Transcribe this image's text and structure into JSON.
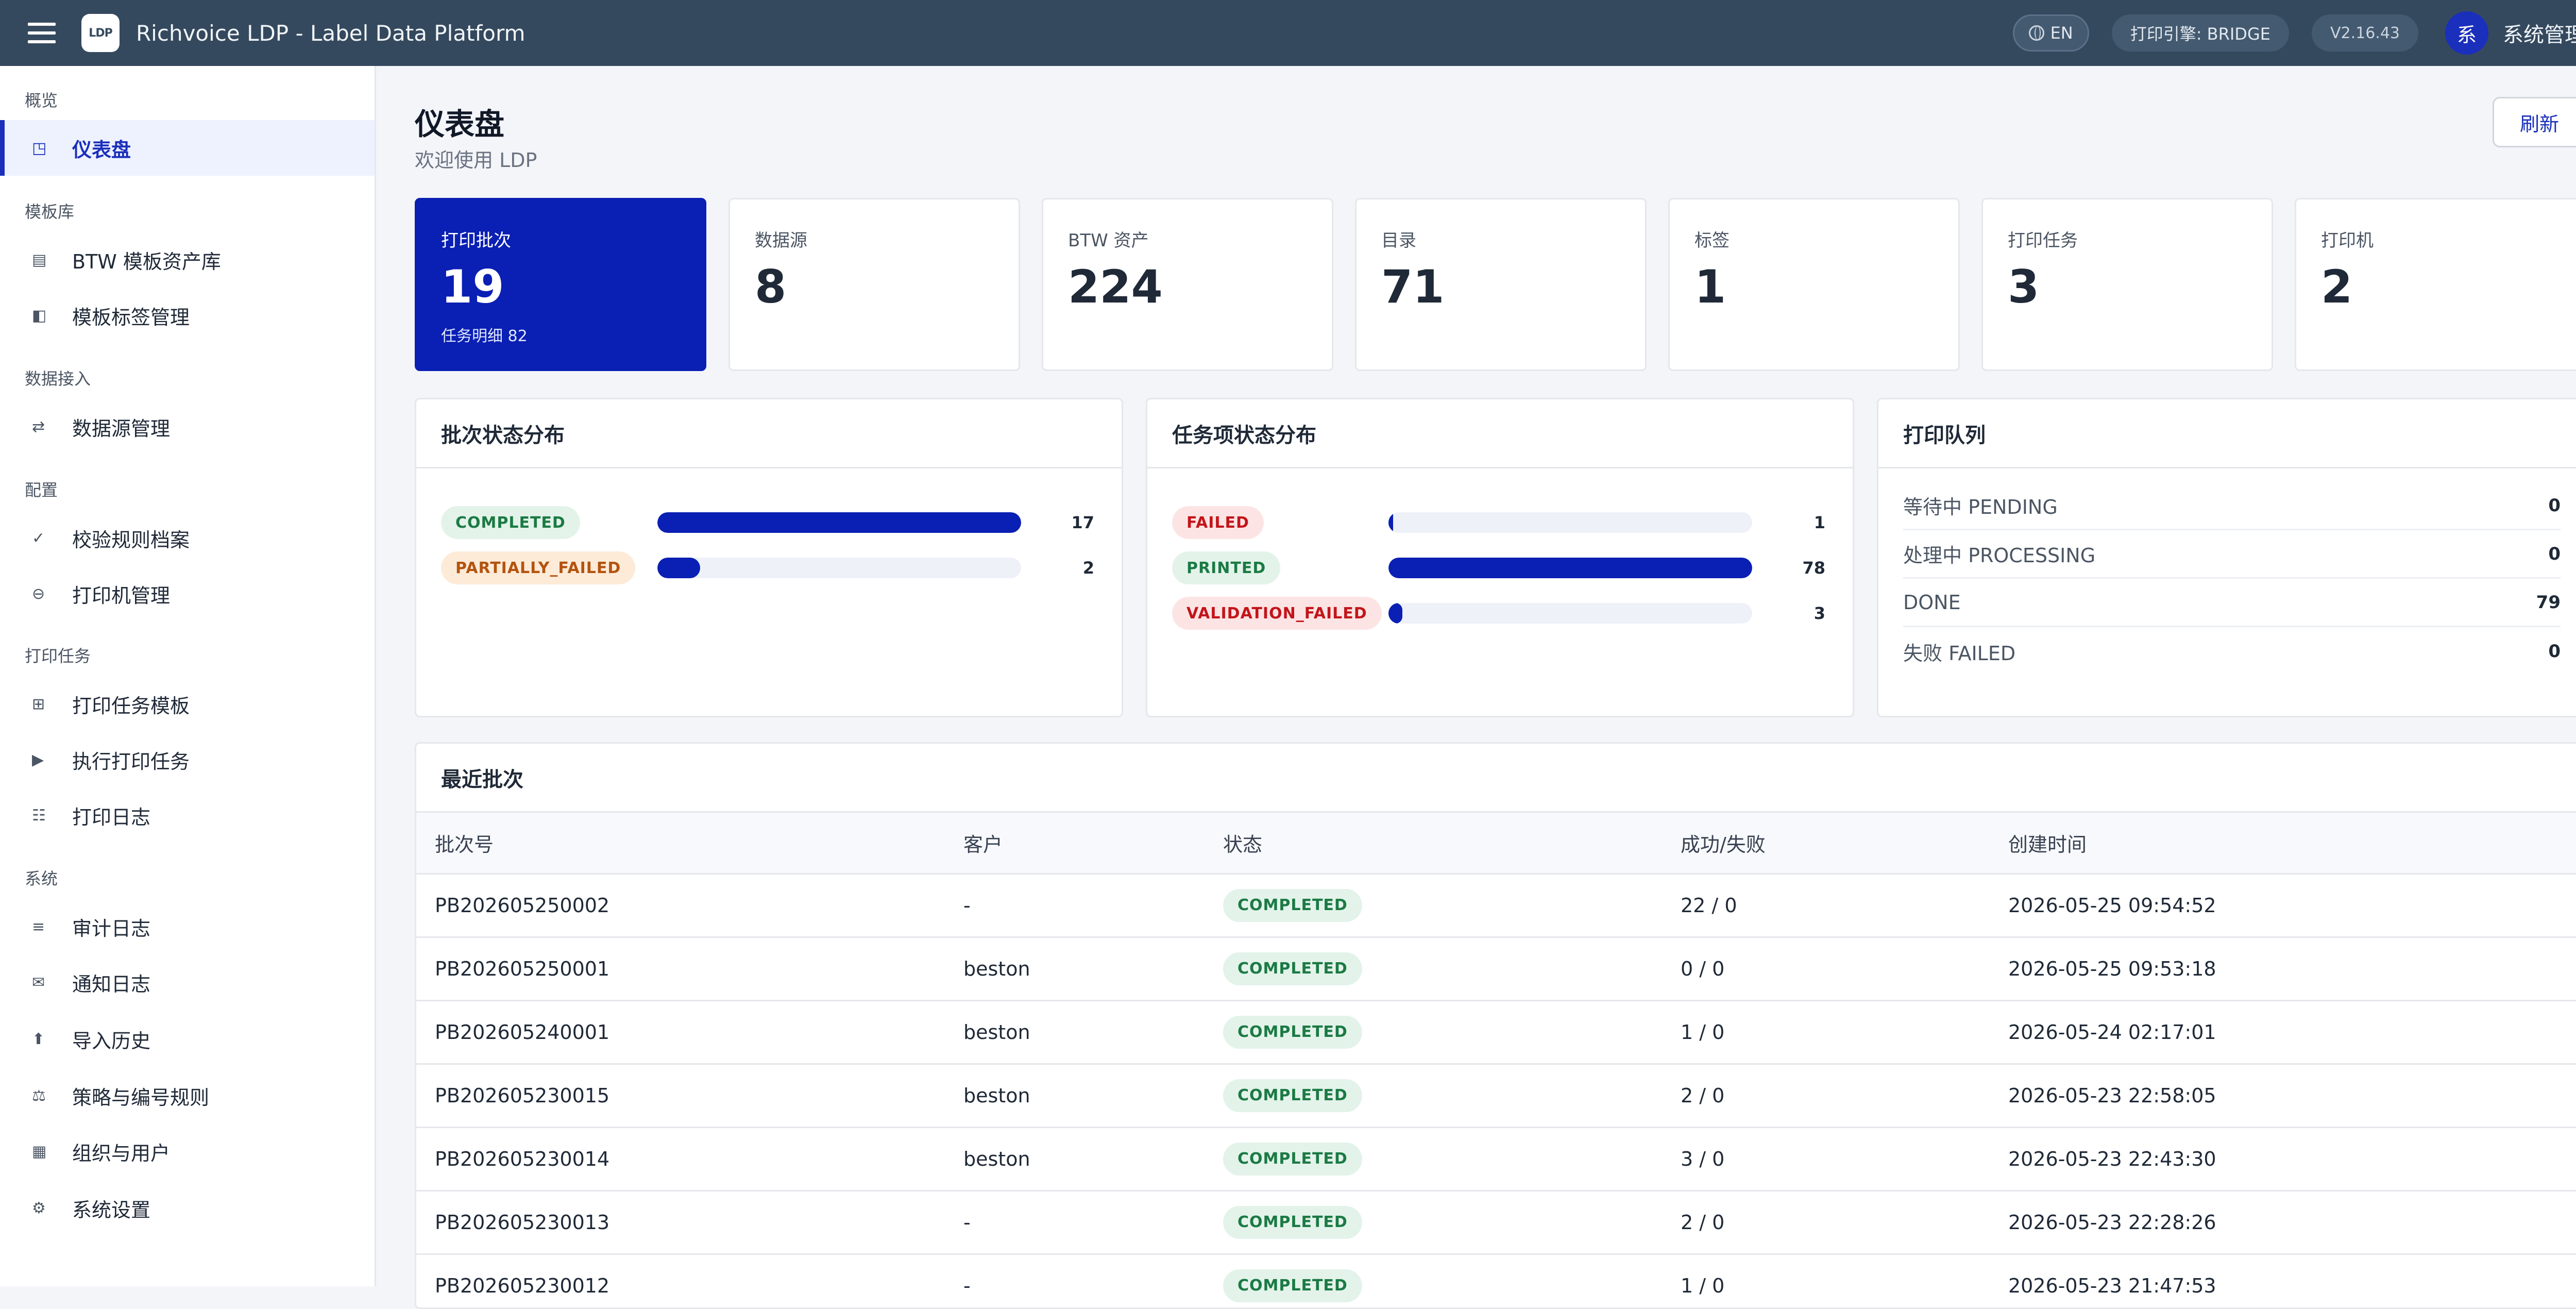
{
  "header": {
    "title": "Richvoice LDP - Label Data Platform",
    "logo_text": "LDP",
    "lang": "EN",
    "engine": "打印引擎: BRIDGE",
    "version": "V2.16.43",
    "avatar": "系",
    "user": "系统管理员"
  },
  "sidebar": {
    "groups": [
      "概览",
      "模板库",
      "数据接入",
      "配置",
      "打印任务",
      "系统"
    ],
    "items": [
      {
        "label": "仪表盘",
        "icon": "dashboard-icon",
        "glyph": "◳"
      },
      {
        "label": "BTW 模板资产库",
        "icon": "template-library-icon",
        "glyph": "▤"
      },
      {
        "label": "模板标签管理",
        "icon": "tag-icon",
        "glyph": "◧"
      },
      {
        "label": "数据源管理",
        "icon": "swap-icon",
        "glyph": "⇄"
      },
      {
        "label": "校验规则档案",
        "icon": "check-icon",
        "glyph": "✓"
      },
      {
        "label": "打印机管理",
        "icon": "printer-icon",
        "glyph": "⊖"
      },
      {
        "label": "打印任务模板",
        "icon": "grid-icon",
        "glyph": "⊞"
      },
      {
        "label": "执行打印任务",
        "icon": "play-icon",
        "glyph": "▶"
      },
      {
        "label": "打印日志",
        "icon": "log-list-icon",
        "glyph": "☷"
      },
      {
        "label": "审计日志",
        "icon": "audit-list-icon",
        "glyph": "≡"
      },
      {
        "label": "通知日志",
        "icon": "mail-icon",
        "glyph": "✉"
      },
      {
        "label": "导入历史",
        "icon": "upload-icon",
        "glyph": "⬆"
      },
      {
        "label": "策略与编号规则",
        "icon": "scale-icon",
        "glyph": "⚖"
      },
      {
        "label": "组织与用户",
        "icon": "building-icon",
        "glyph": "▦"
      },
      {
        "label": "系统设置",
        "icon": "gear-icon",
        "glyph": "⚙"
      }
    ]
  },
  "page": {
    "title": "仪表盘",
    "subtitle": "欢迎使用 LDP",
    "refresh": "刷新"
  },
  "stats": [
    {
      "label": "打印批次",
      "value": "19",
      "sub": "任务明细 82"
    },
    {
      "label": "数据源",
      "value": "8"
    },
    {
      "label": "BTW 资产",
      "value": "224"
    },
    {
      "label": "目录",
      "value": "71"
    },
    {
      "label": "标签",
      "value": "1"
    },
    {
      "label": "打印任务",
      "value": "3"
    },
    {
      "label": "打印机",
      "value": "2"
    }
  ],
  "batch_dist": {
    "title": "批次状态分布",
    "rows": [
      {
        "status": "COMPLETED",
        "count": "17",
        "fraction": 1.0
      },
      {
        "status": "PARTIALLY_FAILED",
        "count": "2",
        "fraction": 0.118
      }
    ]
  },
  "item_dist": {
    "title": "任务项状态分布",
    "rows": [
      {
        "status": "FAILED",
        "count": "1",
        "fraction": 0.013
      },
      {
        "status": "PRINTED",
        "count": "78",
        "fraction": 1.0
      },
      {
        "status": "VALIDATION_FAILED",
        "count": "3",
        "fraction": 0.038
      }
    ]
  },
  "queue": {
    "title": "打印队列",
    "rows": [
      {
        "label": "等待中 PENDING",
        "value": "0"
      },
      {
        "label": "处理中 PROCESSING",
        "value": "0"
      },
      {
        "label": "DONE",
        "value": "79"
      },
      {
        "label": "失败 FAILED",
        "value": "0"
      }
    ]
  },
  "recent": {
    "title": "最近批次",
    "columns": [
      "批次号",
      "客户",
      "状态",
      "成功/失败",
      "创建时间"
    ],
    "rows": [
      [
        "PB202605250002",
        "-",
        "COMPLETED",
        "22 / 0",
        "2026-05-25 09:54:52"
      ],
      [
        "PB202605250001",
        "beston",
        "COMPLETED",
        "0 / 0",
        "2026-05-25 09:53:18"
      ],
      [
        "PB202605240001",
        "beston",
        "COMPLETED",
        "1 / 0",
        "2026-05-24 02:17:01"
      ],
      [
        "PB202605230015",
        "beston",
        "COMPLETED",
        "2 / 0",
        "2026-05-23 22:58:05"
      ],
      [
        "PB202605230014",
        "beston",
        "COMPLETED",
        "3 / 0",
        "2026-05-23 22:43:30"
      ],
      [
        "PB202605230013",
        "-",
        "COMPLETED",
        "2 / 0",
        "2026-05-23 22:28:26"
      ],
      [
        "PB202605230012",
        "-",
        "COMPLETED",
        "1 / 0",
        "2026-05-23 21:47:53"
      ]
    ]
  },
  "colors": {
    "topbar": "#35495e",
    "primary": "#0a1fb3",
    "success": "#1b7a44",
    "warning": "#b4530f",
    "danger": "#c2151b"
  }
}
